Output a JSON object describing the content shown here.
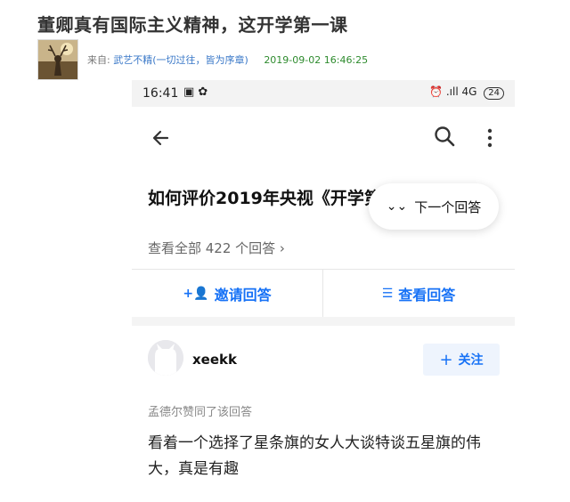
{
  "post": {
    "title": "董卿真有国际主义精神，这开学第一课",
    "from_label": "来自:",
    "author": "武艺不精(一切过往，皆为序章)",
    "timestamp": "2019-09-02 16:46:25"
  },
  "phone": {
    "status_bar": {
      "time": "16:41",
      "left_icons": "▣ ✿",
      "right_text": "⏰ .ıll 4G",
      "battery": "24"
    },
    "nav": {
      "back_icon": "arrow-left",
      "search_icon": "magnifier",
      "more_icon": "vertical-dots"
    },
    "question_title": "如何评价2019年央视《开学第一课》？",
    "next_answer_label": "下一个回答",
    "view_all_label": "查看全部 422 个回答 ›",
    "actions": {
      "invite_label": "邀请回答",
      "view_label": "查看回答"
    },
    "answer": {
      "author": "xeekk",
      "follow_label": "关注",
      "upvote_note": "孟德尔赞同了该回答",
      "text": "看着一个选择了星条旗的女人大谈特谈五星旗的伟大，真是有趣"
    },
    "colors": {
      "accent": "#1772f6",
      "author_link": "#3a78c8",
      "timestamp": "#2e8b2e"
    }
  }
}
